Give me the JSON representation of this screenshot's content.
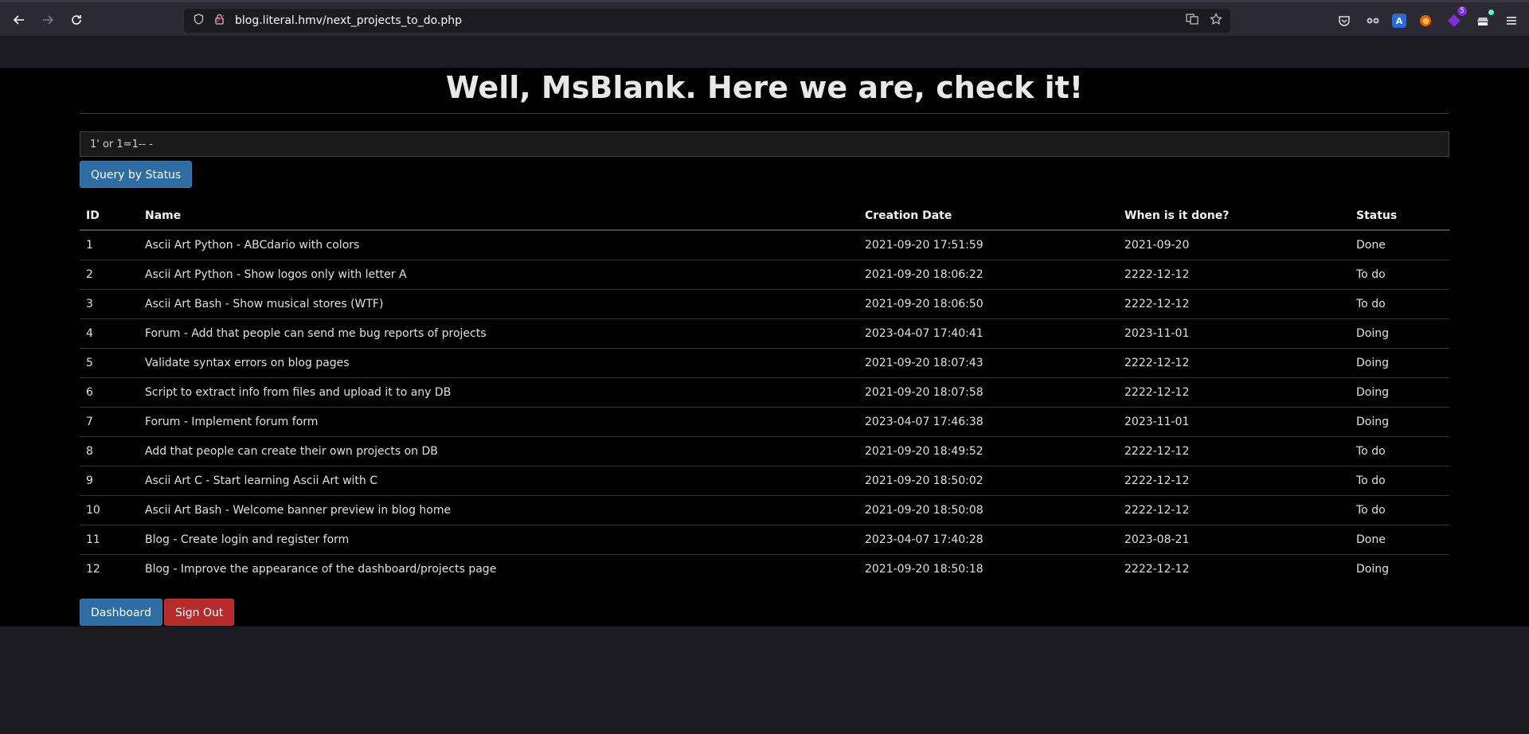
{
  "browser": {
    "url": "blog.literal.hmv/next_projects_to_do.php",
    "extension_badge": "5"
  },
  "header": {
    "greeting_prefix": "Well, ",
    "username": "MsBlank",
    "greeting_suffix": ". Here we are, check it!"
  },
  "search": {
    "value": "1' or 1=1-- -",
    "button_label": "Query by Status"
  },
  "table": {
    "columns": [
      "ID",
      "Name",
      "Creation Date",
      "When is it done?",
      "Status"
    ],
    "rows": [
      [
        "1",
        "Ascii Art Python - ABCdario with colors",
        "2021-09-20 17:51:59",
        "2021-09-20",
        "Done"
      ],
      [
        "2",
        "Ascii Art Python - Show logos only with letter A",
        "2021-09-20 18:06:22",
        "2222-12-12",
        "To do"
      ],
      [
        "3",
        "Ascii Art Bash - Show musical stores (WTF)",
        "2021-09-20 18:06:50",
        "2222-12-12",
        "To do"
      ],
      [
        "4",
        "Forum - Add that people can send me bug reports of projects",
        "2023-04-07 17:40:41",
        "2023-11-01",
        "Doing"
      ],
      [
        "5",
        "Validate syntax errors on blog pages",
        "2021-09-20 18:07:43",
        "2222-12-12",
        "Doing"
      ],
      [
        "6",
        "Script to extract info from files and upload it to any DB",
        "2021-09-20 18:07:58",
        "2222-12-12",
        "Doing"
      ],
      [
        "7",
        "Forum - Implement forum form",
        "2023-04-07 17:46:38",
        "2023-11-01",
        "Doing"
      ],
      [
        "8",
        "Add that people can create their own projects on DB",
        "2021-09-20 18:49:52",
        "2222-12-12",
        "To do"
      ],
      [
        "9",
        "Ascii Art C - Start learning Ascii Art with C",
        "2021-09-20 18:50:02",
        "2222-12-12",
        "To do"
      ],
      [
        "10",
        "Ascii Art Bash - Welcome banner preview in blog home",
        "2021-09-20 18:50:08",
        "2222-12-12",
        "To do"
      ],
      [
        "11",
        "Blog - Create login and register form",
        "2023-04-07 17:40:28",
        "2023-08-21",
        "Done"
      ],
      [
        "12",
        "Blog - Improve the appearance of the dashboard/projects page",
        "2021-09-20 18:50:18",
        "2222-12-12",
        "Doing"
      ]
    ]
  },
  "footer": {
    "dashboard_label": "Dashboard",
    "signout_label": "Sign Out"
  },
  "colors": {
    "page_bg": "#000000",
    "primary_button": "#2e6da4",
    "danger_button": "#b52b2b",
    "chrome_bg": "#2b2a33"
  }
}
